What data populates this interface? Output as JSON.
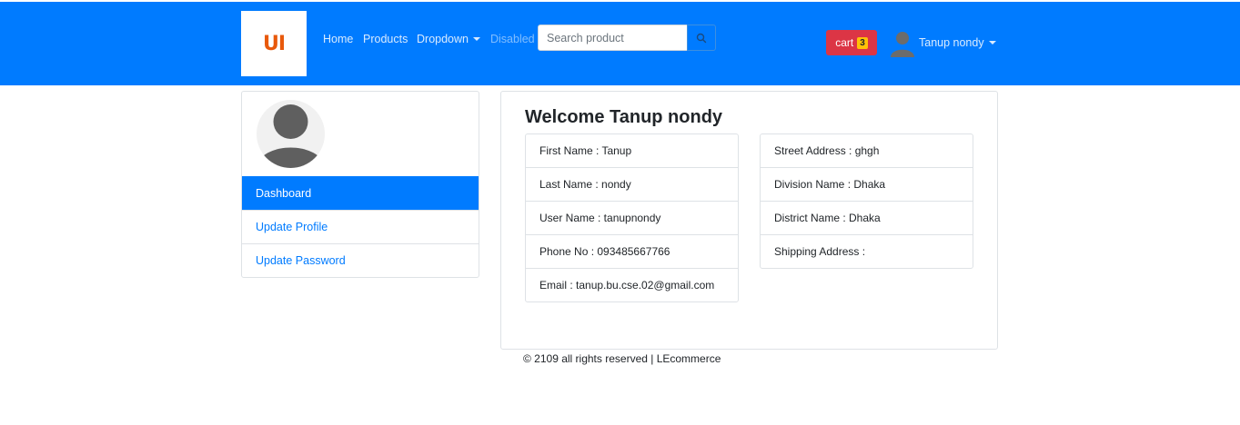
{
  "navbar": {
    "logo_text": "UI",
    "links": {
      "home": "Home",
      "products": "Products",
      "dropdown": "Dropdown",
      "disabled": "Disabled"
    },
    "search": {
      "placeholder": "Search product",
      "value": "",
      "button_icon": "search-icon"
    },
    "cart": {
      "label": "cart",
      "count": "3"
    },
    "user": {
      "name": "Tanup nondy",
      "avatar_icon": "user-avatar-icon"
    },
    "colors": {
      "primary": "#007bff",
      "cart": "#dc3545",
      "badge": "#ffc107",
      "logo": "#e8590c"
    }
  },
  "sidebar": {
    "profile_icon": "default-profile-avatar",
    "items": [
      {
        "label": "Dashboard",
        "active": true
      },
      {
        "label": "Update Profile",
        "active": false
      },
      {
        "label": "Update Password",
        "active": false
      }
    ]
  },
  "main": {
    "welcome": "Welcome Tanup nondy",
    "left_details": [
      "First Name : Tanup",
      "Last Name : nondy",
      "User Name : tanupnondy",
      "Phone No : 093485667766",
      "Email : tanup.bu.cse.02@gmail.com"
    ],
    "right_details": [
      "Street Address : ghgh",
      "Division Name : Dhaka",
      "District Name : Dhaka",
      "Shipping Address :"
    ]
  },
  "footer": {
    "text": "© 2109 all rights reserved | LEcommerce"
  }
}
